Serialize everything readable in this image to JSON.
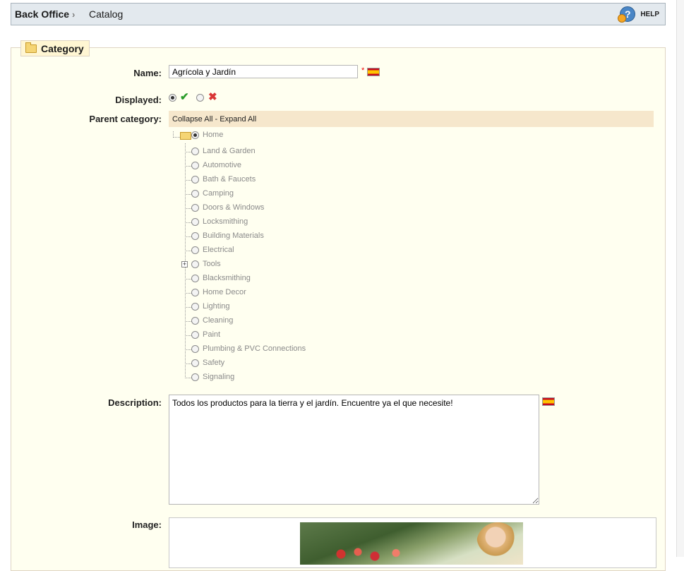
{
  "breadcrumb": {
    "root": "Back Office",
    "separator": "›",
    "current": "Catalog"
  },
  "help": {
    "icon": "help-icon",
    "label": "HELP"
  },
  "section": {
    "title": "Category",
    "icon": "folder-icon"
  },
  "form": {
    "name": {
      "label": "Name:",
      "value": "Agrícola y Jardín",
      "required_mark": "*",
      "language_flag": "spain-flag-icon"
    },
    "displayed": {
      "label": "Displayed:",
      "yes_icon": "check-icon",
      "no_icon": "cross-icon",
      "selected": "yes"
    },
    "parent_category": {
      "label": "Parent category:",
      "toolbar": "Collapse All - Expand All",
      "root": "Home",
      "items": [
        "Land & Garden",
        "Automotive",
        "Bath & Faucets",
        "Camping",
        "Doors & Windows",
        "Locksmithing",
        "Building Materials",
        "Electrical",
        "Tools",
        "Blacksmithing",
        "Home Decor",
        "Lighting",
        "Cleaning",
        "Paint",
        "Plumbing & PVC Connections",
        "Safety",
        "Signaling"
      ],
      "expandable_item": "Tools"
    },
    "description": {
      "label": "Description:",
      "value": "Todos los productos para la tierra y el jardín. Encuentre ya el que necesite!",
      "language_flag": "spain-flag-icon"
    },
    "image": {
      "label": "Image:"
    }
  },
  "colors": {
    "fieldset_bg": "#fffff0",
    "tree_bar_bg": "#f6e7cc",
    "topbar_bg": "#e3e9ee"
  }
}
